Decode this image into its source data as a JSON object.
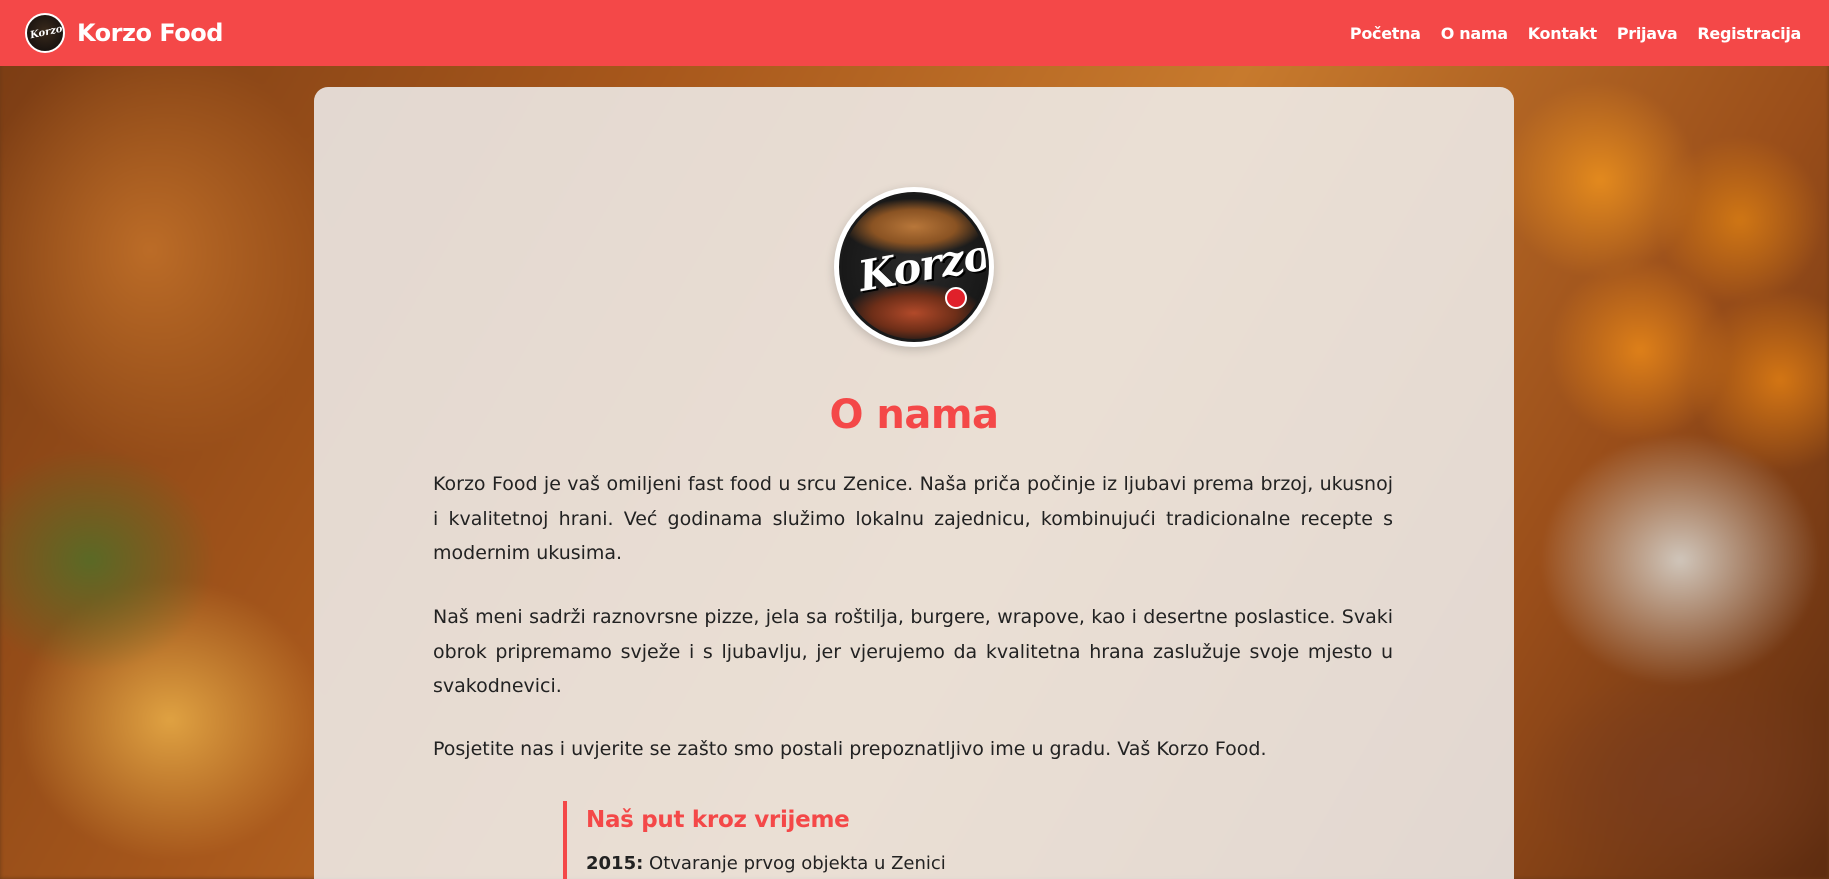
{
  "navbar": {
    "brand_name": "Korzo Food",
    "logo_text": "Korzo",
    "links": [
      {
        "label": "Početna"
      },
      {
        "label": "O nama"
      },
      {
        "label": "Kontakt"
      },
      {
        "label": "Prijava"
      },
      {
        "label": "Registracija"
      }
    ]
  },
  "main": {
    "logo_text": "Korzo",
    "title": "O nama",
    "paragraphs": [
      "Korzo Food je vaš omiljeni fast food u srcu Zenice. Naša priča počinje iz ljubavi prema brzoj, ukusnoj i kvalitetnoj hrani. Već godinama služimo lokalnu zajednicu, kombinujući tradicionalne recepte s modernim ukusima.",
      "Naš meni sadrži raznovrsne pizze, jela sa roštilja, burgere, wrapove, kao i desertne poslastice. Svaki obrok pripremamo svježe i s ljubavlju, jer vjerujemo da kvalitetna hrana zaslužuje svoje mjesto u svakodnevici.",
      "Posjetite nas i uvjerite se zašto smo postali prepoznatljivo ime u gradu. Vaš Korzo Food."
    ],
    "timeline": {
      "title": "Naš put kroz vrijeme",
      "items": [
        {
          "year": "2015:",
          "text": "Otvaranje prvog objekta u Zenici"
        }
      ]
    }
  },
  "colors": {
    "accent": "#f44848",
    "text": "#222222",
    "card_background": "#f0f0f0"
  },
  "icons": {
    "brand_logo": "korzo-logo-icon"
  }
}
